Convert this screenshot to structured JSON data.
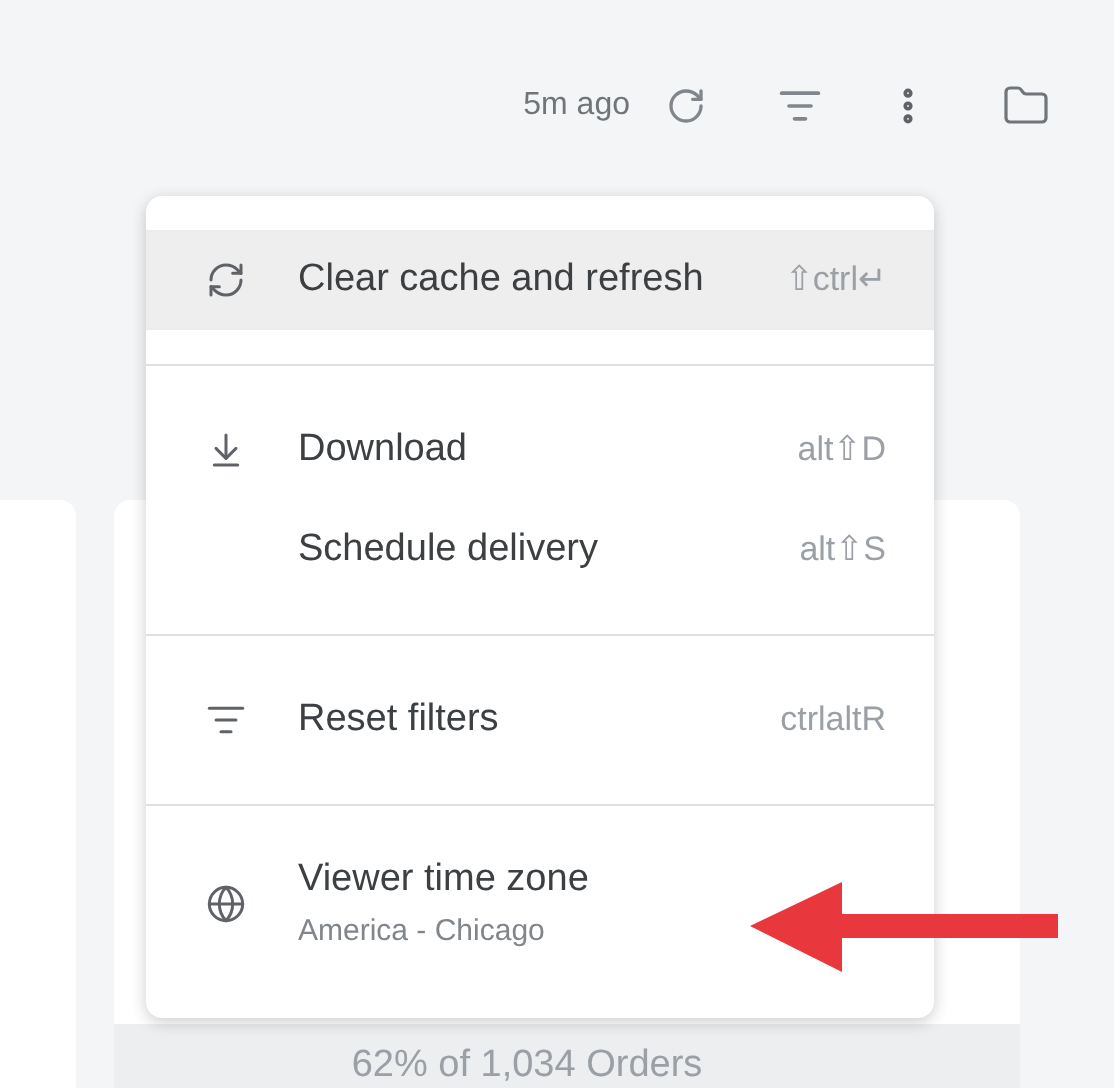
{
  "toolbar": {
    "updated": "5m ago"
  },
  "menu": {
    "sections": [
      {
        "items": [
          {
            "kind": "shortcut",
            "label": "Clear cache and refresh",
            "shortcut": "⇧ctrl↵",
            "highlighted": true
          }
        ]
      },
      {
        "items": [
          {
            "kind": "shortcut",
            "label": "Download",
            "shortcut": "alt⇧D",
            "highlighted": false
          },
          {
            "kind": "shortcut",
            "label": "Schedule delivery",
            "shortcut": "alt⇧S",
            "highlighted": false
          }
        ]
      },
      {
        "items": [
          {
            "kind": "shortcut",
            "label": "Reset filters",
            "shortcut": "ctrlaltR",
            "highlighted": false
          }
        ]
      },
      {
        "items": [
          {
            "kind": "subtitle",
            "label": "Viewer time zone",
            "subtitle": "America - Chicago",
            "highlighted": false
          }
        ]
      }
    ]
  },
  "footer": {
    "summary": "62% of 1,034 Orders"
  }
}
